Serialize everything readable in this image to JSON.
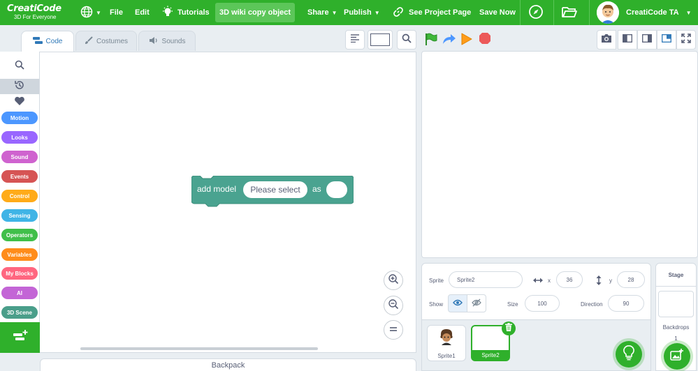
{
  "brand": {
    "name": "CreatiCode",
    "tagline": "3D For Everyone"
  },
  "menu": {
    "file": "File",
    "edit": "Edit",
    "tutorials": "Tutorials",
    "project_title": "3D wiki copy object",
    "share": "Share",
    "publish": "Publish",
    "see_project_page": "See Project Page",
    "save_now": "Save Now",
    "user_name": "CreatiCode TA"
  },
  "tabs": {
    "code": "Code",
    "costumes": "Costumes",
    "sounds": "Sounds"
  },
  "categories": [
    {
      "label": "Motion",
      "color": "#4c97ff"
    },
    {
      "label": "Looks",
      "color": "#9966ff"
    },
    {
      "label": "Sound",
      "color": "#cf63cf"
    },
    {
      "label": "Events",
      "color": "#d65454"
    },
    {
      "label": "Control",
      "color": "#ffab19"
    },
    {
      "label": "Sensing",
      "color": "#3fb4e6"
    },
    {
      "label": "Operators",
      "color": "#40bf4a"
    },
    {
      "label": "Variables",
      "color": "#ff8c1a"
    },
    {
      "label": "My Blocks",
      "color": "#ff6680"
    },
    {
      "label": "AI",
      "color": "#c365d6"
    },
    {
      "label": "3D Scene",
      "color": "#4a9e8a"
    }
  ],
  "block": {
    "prefix": "add model",
    "dropdown": "Please select",
    "as_label": "as",
    "color": "#4aa390"
  },
  "backpack": "Backpack",
  "sprite_info": {
    "sprite_label": "Sprite",
    "sprite_name": "Sprite2",
    "x_label": "x",
    "x_value": "36",
    "y_label": "y",
    "y_value": "28",
    "show_label": "Show",
    "size_label": "Size",
    "size_value": "100",
    "direction_label": "Direction",
    "direction_value": "90"
  },
  "sprites": [
    {
      "name": "Sprite1",
      "selected": false
    },
    {
      "name": "Sprite2",
      "selected": true
    }
  ],
  "stage_panel": {
    "title": "Stage",
    "backdrops_label": "Backdrops",
    "backdrops_count": "1"
  },
  "colors": {
    "menubar": "#2fb02b",
    "accent": "#2fb02b",
    "tab_active_text": "#3079b8"
  }
}
